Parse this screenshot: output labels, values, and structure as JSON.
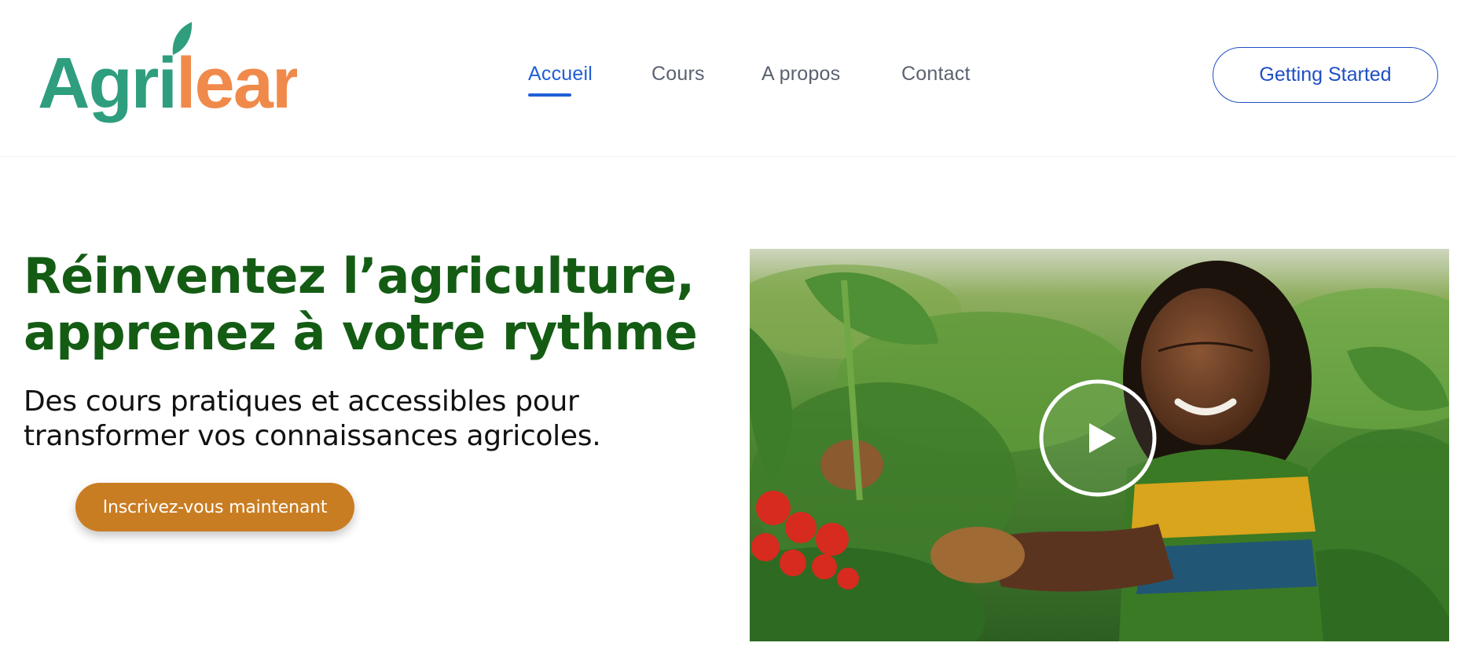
{
  "header": {
    "logo": {
      "part1": "Agri",
      "part2": "learn",
      "color1": "#2e9e7e",
      "color2": "#f08a4b"
    },
    "nav": [
      {
        "label": "Accueil",
        "active": true
      },
      {
        "label": "Cours",
        "active": false
      },
      {
        "label": "A propos",
        "active": false
      },
      {
        "label": "Contact",
        "active": false
      }
    ],
    "cta_label": "Getting Started"
  },
  "hero": {
    "title_line1": "Réinventez l’agriculture,",
    "title_line2": "apprenez à votre rythme",
    "subtitle_line1": "Des cours pratiques et accessibles pour",
    "subtitle_line2": "transformer vos connaissances agricoles.",
    "signup_label": "Inscrivez-vous maintenant",
    "media": {
      "icon": "play-icon"
    }
  },
  "colors": {
    "accent": "#1f5fd6",
    "title_green": "#145c14",
    "button_orange": "#c97d22"
  }
}
